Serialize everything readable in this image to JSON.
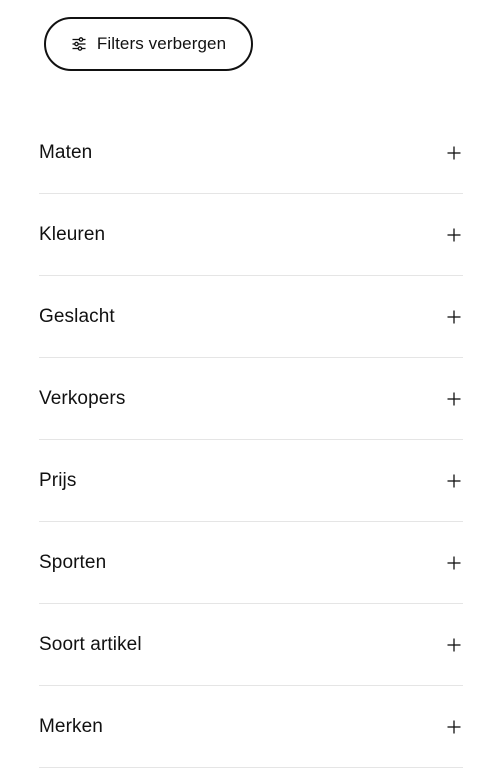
{
  "filters_toggle": {
    "label": "Filters verbergen",
    "icon": "sliders-icon"
  },
  "filter_sections": [
    {
      "label": "Maten",
      "icon": "plus-icon"
    },
    {
      "label": "Kleuren",
      "icon": "plus-icon"
    },
    {
      "label": "Geslacht",
      "icon": "plus-icon"
    },
    {
      "label": "Verkopers",
      "icon": "plus-icon"
    },
    {
      "label": "Prijs",
      "icon": "plus-icon"
    },
    {
      "label": "Sporten",
      "icon": "plus-icon"
    },
    {
      "label": "Soort artikel",
      "icon": "plus-icon"
    },
    {
      "label": "Merken",
      "icon": "plus-icon"
    }
  ],
  "colors": {
    "text": "#111111",
    "divider": "#e5e5e5",
    "background": "#ffffff"
  }
}
